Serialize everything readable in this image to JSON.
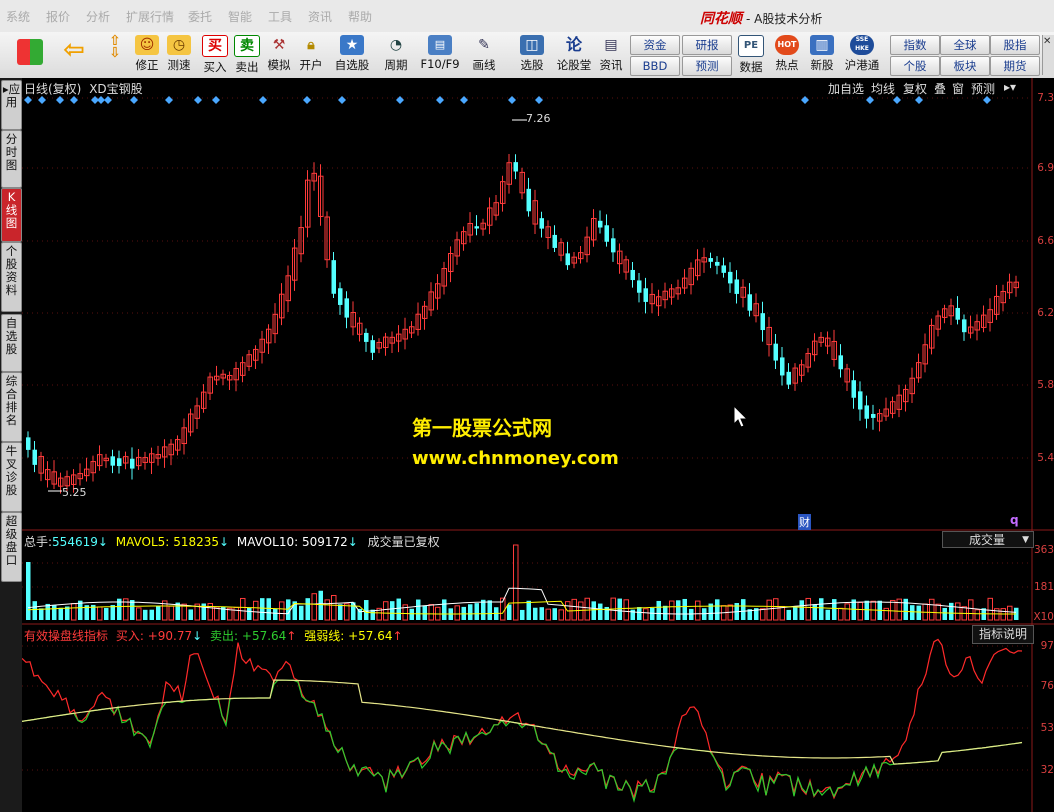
{
  "menubar": {
    "items": [
      "系统",
      "报价",
      "分析",
      "扩展行情",
      "委托",
      "智能",
      "工具",
      "资讯",
      "帮助"
    ],
    "brand": "同花顺",
    "subtitle": "- A股技术分析"
  },
  "toolbar": {
    "buttons": [
      {
        "label": "修正"
      },
      {
        "label": "测速"
      },
      {
        "label": "买入"
      },
      {
        "label": "卖出"
      },
      {
        "label": "模拟"
      },
      {
        "label": "开户"
      },
      {
        "label": "自选股"
      },
      {
        "label": "周期"
      },
      {
        "label": "F10/F9"
      },
      {
        "label": "画线"
      },
      {
        "label": "选股"
      },
      {
        "label": "论股堂"
      },
      {
        "label": "资讯"
      },
      {
        "label": "数据"
      },
      {
        "label": "热点"
      },
      {
        "label": "新股"
      },
      {
        "label": "沪港通"
      }
    ],
    "small_buttons": [
      "资金",
      "BBD",
      "研报",
      "预测",
      "指数",
      "个股",
      "全球",
      "板块",
      "股指",
      "期货"
    ],
    "icon_texts": {
      "buy": "买",
      "sell": "卖",
      "pe": "PE",
      "hot": "HOT",
      "hk": "SSE HKE"
    }
  },
  "sidebar": {
    "tabs": [
      "应用",
      "分时图",
      "K线图",
      "个股资料",
      "自选股",
      "综合排名",
      "牛叉诊股",
      "超级盘口"
    ]
  },
  "chart": {
    "title": "日线(复权)",
    "stock": "XD宝钢股",
    "buttons": [
      "加自选",
      "均线",
      "复权",
      "叠",
      "窗",
      "预测"
    ],
    "price_axis": [
      "7.3",
      "6.9",
      "6.6",
      "6.2",
      "5.8",
      "5.4"
    ],
    "high_label": "7.26",
    "low_label": "5.25",
    "finance_mark": "财",
    "q_mark": "q",
    "watermark_title": "第一股票公式网",
    "watermark_url": "www.chnmoney.com"
  },
  "volume": {
    "total_label": "总手:",
    "total_value": "554619",
    "ma5_label": "MAVOL5:",
    "ma5_value": "518235",
    "ma10_label": "MAVOL10:",
    "ma10_value": "509172",
    "note": "成交量已复权",
    "select_value": "成交量",
    "axis": [
      "363",
      "181",
      "X10"
    ]
  },
  "indicator": {
    "name": "有效操盘线指标",
    "buy_label": "买入:",
    "buy_value": "+90.77",
    "sell_label": "卖出:",
    "sell_value": "+57.64",
    "strength_label": "强弱线:",
    "strength_value": "+57.64",
    "button": "指标说明",
    "axis": [
      "97",
      "76",
      "53",
      "32"
    ]
  },
  "colors": {
    "up": "#ff3b3b",
    "down": "#54ffff",
    "ma5": "#ffffff",
    "ma10": "#ffff00",
    "green": "#2ecc2e",
    "diamond": "#4aa8ff"
  }
}
